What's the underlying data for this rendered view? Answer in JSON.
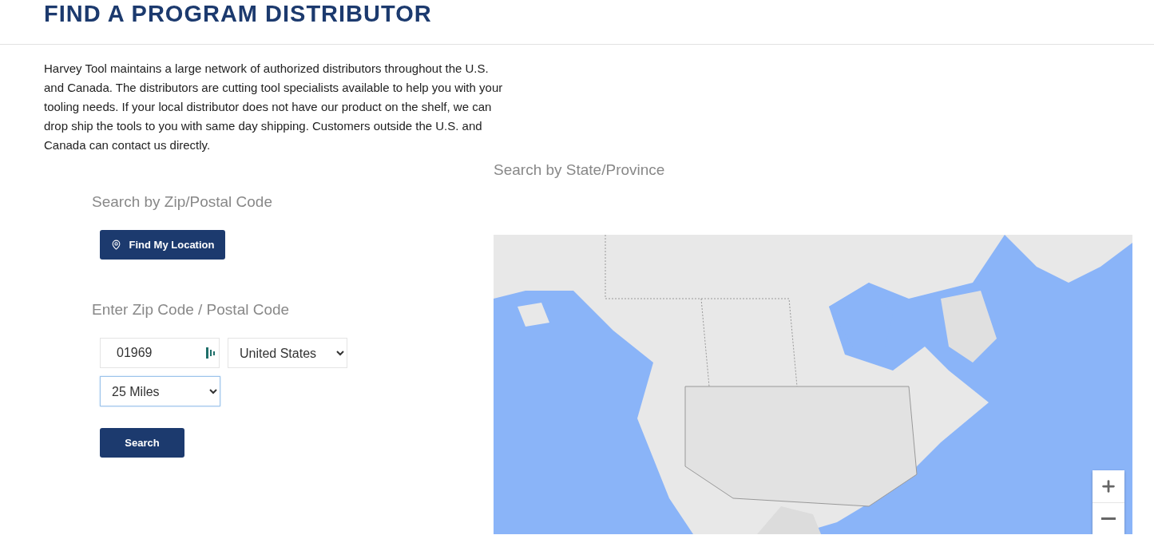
{
  "page_title": "FIND A PROGRAM DISTRIBUTOR",
  "intro": "Harvey Tool maintains a large network of authorized distributors throughout the U.S. and Canada. The distributors are cutting tool specialists available to help you with your tooling needs. If your local distributor does not have our product on the shelf, we can drop ship the tools to you with same day shipping. Customers outside the U.S. and Canada can contact us directly.",
  "zip_search": {
    "heading": "Search by Zip/Postal Code",
    "locate_button": "Find My Location",
    "form_heading": "Enter Zip Code / Postal Code",
    "zip_value": "01969",
    "country": "United States",
    "radius": "25 Miles",
    "radius_focused": true,
    "search_button": "Search"
  },
  "state_search": {
    "heading": "Search by State/Province"
  }
}
